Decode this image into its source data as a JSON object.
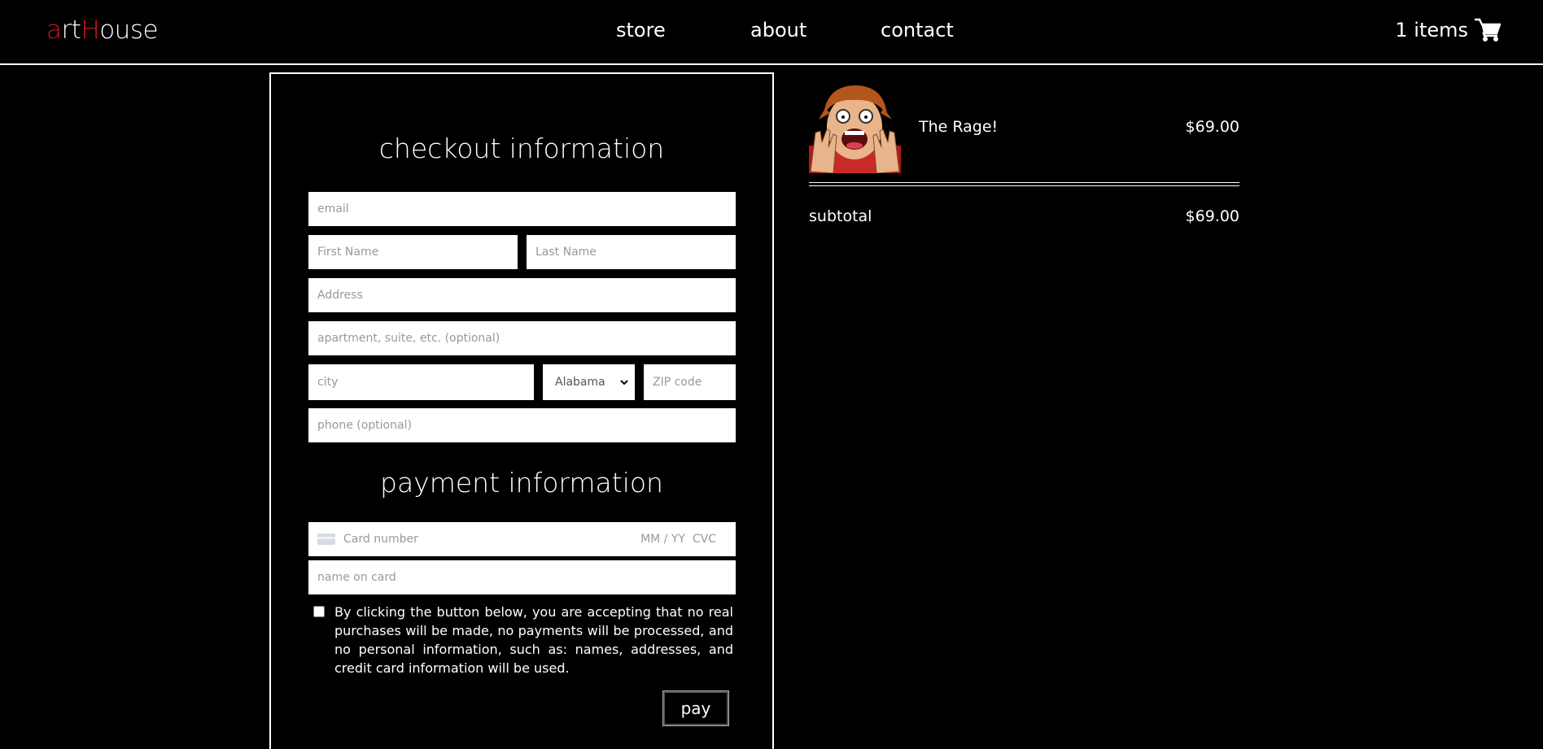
{
  "header": {
    "logo": {
      "part1": "a",
      "part2": "rt",
      "part3": "H",
      "part4": "ouse"
    },
    "nav": [
      "store",
      "about",
      "contact"
    ],
    "cart_label": "1 items",
    "cart_icon": "shopping-cart-icon",
    "accent": "#d0191f"
  },
  "checkout": {
    "title": "checkout information",
    "email_placeholder": "email",
    "first_name_placeholder": "First Name",
    "last_name_placeholder": "Last Name",
    "address_placeholder": "Address",
    "apartment_placeholder": "apartment, suite, etc. (optional)",
    "city_placeholder": "city",
    "state_selected": "Alabama",
    "zip_placeholder": "ZIP code",
    "phone_placeholder": "phone (optional)"
  },
  "payment": {
    "title": "payment information",
    "card_number_placeholder": "Card number",
    "card_exp_cvc_placeholder": "MM / YY  CVC",
    "name_on_card_placeholder": "name on card",
    "terms": "By clicking the button below, you are accepting that no real purchases will be made, no payments will be processed, and no personal information, such as: names, addresses, and credit card information will be used.",
    "pay_label": "pay"
  },
  "summary": {
    "items": [
      {
        "name": "The Rage!",
        "price": "$69.00"
      }
    ],
    "subtotal_label": "subtotal",
    "subtotal_value": "$69.00"
  }
}
